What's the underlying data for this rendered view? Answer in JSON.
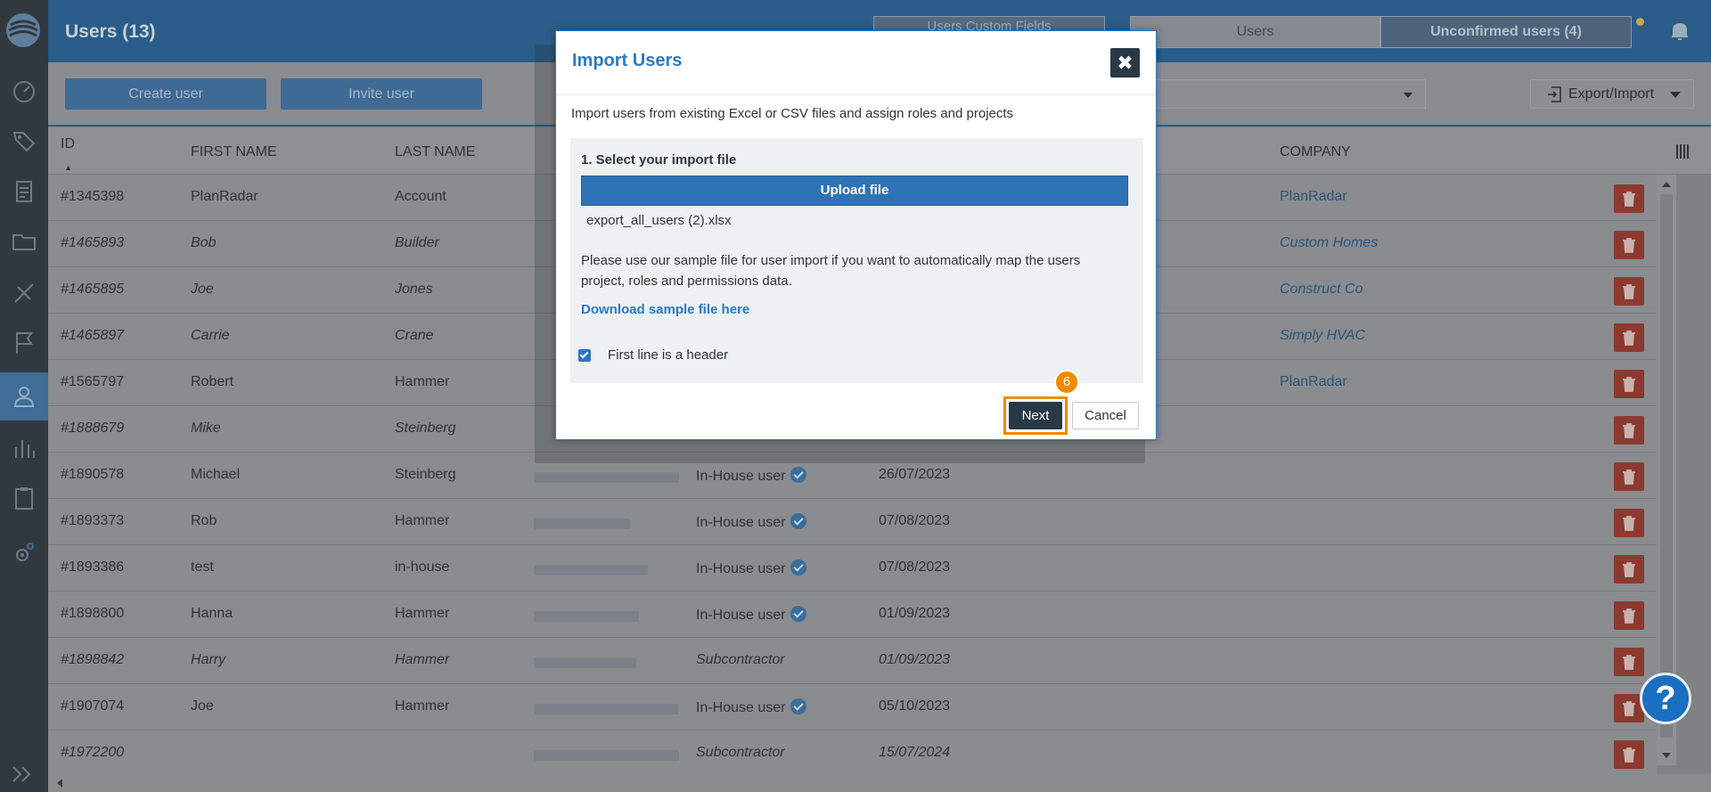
{
  "header": {
    "page_title": "Users (13)",
    "custom_fields_tab": "Users Custom Fields",
    "tabs": [
      {
        "label": "Users"
      },
      {
        "label": "Unconfirmed users (4)"
      }
    ]
  },
  "toolbar": {
    "create_user": "Create user",
    "invite_user": "Invite user",
    "export_import": "Export/Import"
  },
  "table": {
    "columns": {
      "id": "ID",
      "first_name": "FIRST NAME",
      "last_name": "LAST NAME",
      "company": "COMPANY"
    },
    "rows": [
      {
        "id": "#1345398",
        "first": "PlanRadar",
        "last": "Account",
        "role": "",
        "date": "",
        "company": "PlanRadar",
        "italic": false
      },
      {
        "id": "#1465893",
        "first": "Bob",
        "last": "Builder",
        "role": "",
        "date": "",
        "company": "Custom Homes",
        "italic": true
      },
      {
        "id": "#1465895",
        "first": "Joe",
        "last": "Jones",
        "role": "",
        "date": "",
        "company": "Construct Co",
        "italic": true
      },
      {
        "id": "#1465897",
        "first": "Carrie",
        "last": "Crane",
        "role": "",
        "date": "",
        "company": "Simply HVAC",
        "italic": true
      },
      {
        "id": "#1565797",
        "first": "Robert",
        "last": "Hammer",
        "role": "",
        "date": "",
        "company": "PlanRadar",
        "italic": false
      },
      {
        "id": "#1888679",
        "first": "Mike",
        "last": "Steinberg",
        "role": "",
        "date": "",
        "company": "",
        "italic": true
      },
      {
        "id": "#1890578",
        "first": "Michael",
        "last": "Steinberg",
        "role": "In-House user",
        "date": "26/07/2023",
        "company": "",
        "italic": false
      },
      {
        "id": "#1893373",
        "first": "Rob",
        "last": "Hammer",
        "role": "In-House user",
        "date": "07/08/2023",
        "company": "",
        "italic": false
      },
      {
        "id": "#1893386",
        "first": "test",
        "last": "in-house",
        "role": "In-House user",
        "date": "07/08/2023",
        "company": "",
        "italic": false
      },
      {
        "id": "#1898800",
        "first": "Hanna",
        "last": "Hammer",
        "role": "In-House user",
        "date": "01/09/2023",
        "company": "",
        "italic": false
      },
      {
        "id": "#1898842",
        "first": "Harry",
        "last": "Hammer",
        "role": "Subcontractor",
        "date": "01/09/2023",
        "company": "",
        "italic": true
      },
      {
        "id": "#1907074",
        "first": "Joe",
        "last": "Hammer",
        "role": "In-House user",
        "date": "05/10/2023",
        "company": "",
        "italic": false
      },
      {
        "id": "#1972200",
        "first": "",
        "last": "",
        "role": "Subcontractor",
        "date": "15/07/2024",
        "company": "",
        "italic": true
      }
    ]
  },
  "modal": {
    "title": "Import Users",
    "close_label": "✖",
    "description": "Import users from existing Excel or CSV files and assign roles and projects",
    "step_label": "1. Select your import file",
    "upload_label": "Upload file",
    "filename": "export_all_users (2).xlsx",
    "sample_note": "Please use our sample file for user import if you want to automatically map the users project, roles and permissions data.",
    "sample_link": "Download sample file here",
    "header_checkbox_label": "First line is a header",
    "next_label": "Next",
    "cancel_label": "Cancel",
    "step_badge": "6"
  },
  "help": {
    "label": "?"
  },
  "colors": {
    "primary": "#2a5d8a",
    "accent": "#2b7ac4",
    "highlight": "#f08a00",
    "danger": "#c0392b"
  },
  "icons": [
    "logo-icon",
    "dashboard-icon",
    "tag-icon",
    "report-icon",
    "folder-icon",
    "tools-icon",
    "flag-icon",
    "user-icon",
    "stats-icon",
    "clipboard-icon",
    "settings-icon",
    "expand-icon",
    "bell-icon",
    "export-icon",
    "trash-icon",
    "check-icon"
  ]
}
